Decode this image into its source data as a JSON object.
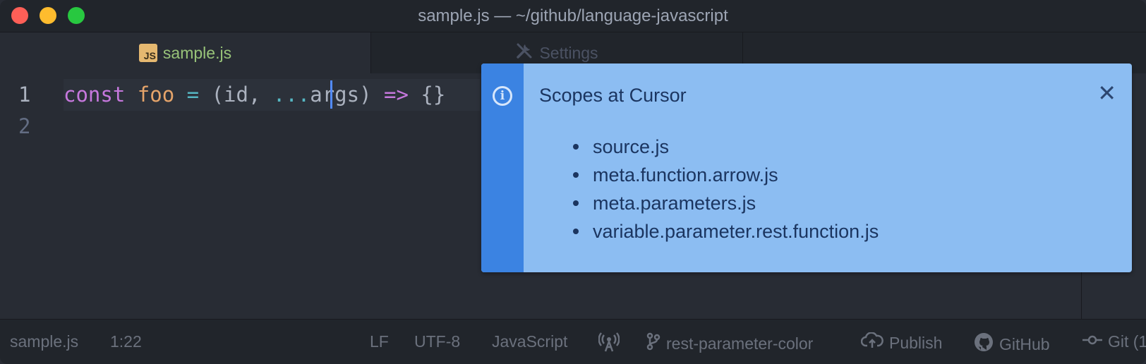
{
  "window": {
    "title": "sample.js — ~/github/language-javascript"
  },
  "tabs": [
    {
      "label": "sample.js",
      "icon": "js-file-icon",
      "badge": "JS",
      "active": true
    },
    {
      "label": "Settings",
      "icon": "tools-icon",
      "active": false
    }
  ],
  "editor": {
    "lines": [
      {
        "number": "1",
        "tokens": {
          "kw": "const",
          "sp1": " ",
          "name": "foo",
          "sp2": " ",
          "eq": "=",
          "paren_open": " (id, ",
          "rest": "...",
          "args": "args",
          "paren_close": ") ",
          "arrow": "=>",
          "body": " {}"
        }
      },
      {
        "number": "2"
      }
    ],
    "cursor_column": 22
  },
  "notification": {
    "type": "info",
    "title": "Scopes at Cursor",
    "scopes": [
      "source.js",
      "meta.function.arrow.js",
      "meta.parameters.js",
      "variable.parameter.rest.function.js"
    ],
    "colors": {
      "background": "#8cbdf2",
      "strip": "#3b83e2",
      "text": "#1b3560"
    }
  },
  "statusbar": {
    "file": "sample.js",
    "position": "1:22",
    "line_ending": "LF",
    "encoding": "UTF-8",
    "grammar": "JavaScript",
    "branch": "rest-parameter-color",
    "publish": "Publish",
    "github": "GitHub",
    "git": "Git (1"
  },
  "colors": {
    "editor_bg": "#282c34",
    "chrome_bg": "#21252b",
    "keyword": "#c678dd",
    "function_name": "#e5a46a",
    "operator": "#56b6c2",
    "active_tab_text": "#98c379",
    "cursor": "#528bff"
  }
}
